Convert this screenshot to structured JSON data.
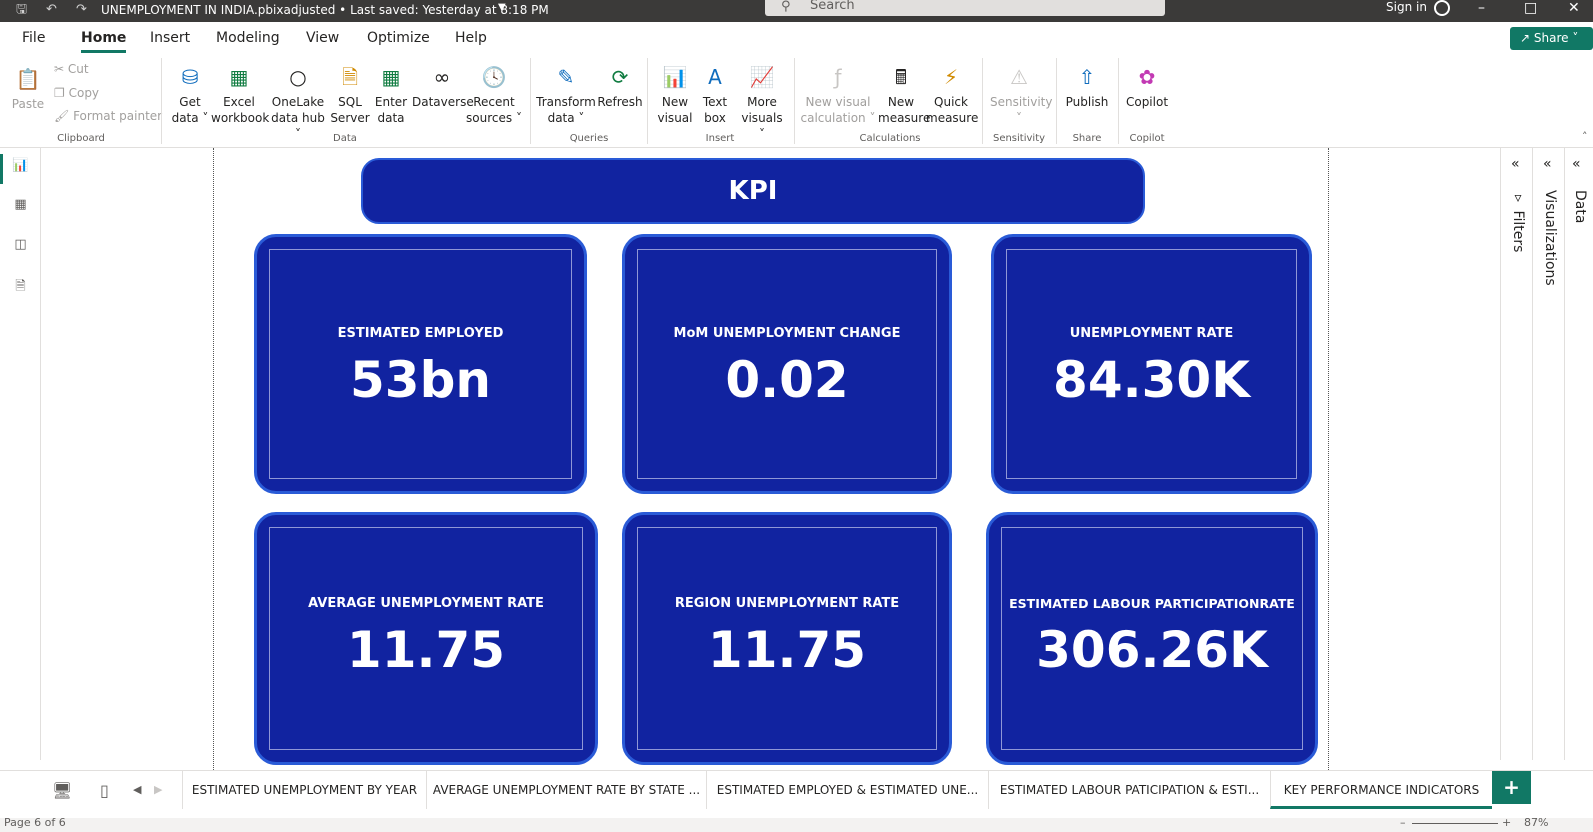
{
  "titlebar": {
    "document_title": "UNEMPLOYMENT IN INDIA.pbixadjusted",
    "saved_status": "• Last saved: Yesterday at 8:18 PM",
    "search_placeholder": "Search",
    "sign_in": "Sign in"
  },
  "menu": {
    "tabs": [
      "File",
      "Home",
      "Insert",
      "Modeling",
      "View",
      "Optimize",
      "Help"
    ],
    "active": "Home",
    "share_label": "Share"
  },
  "ribbon": {
    "clipboard": {
      "paste": "Paste",
      "cut": "Cut",
      "copy": "Copy",
      "format_painter": "Format painter",
      "group": "Clipboard"
    },
    "data": {
      "get_data": [
        "Get",
        "data ˅"
      ],
      "excel": [
        "Excel",
        "workbook"
      ],
      "onelake": [
        "OneLake",
        "data hub ˅"
      ],
      "sql": [
        "SQL",
        "Server"
      ],
      "enter": [
        "Enter",
        "data"
      ],
      "dataverse": [
        "Dataverse"
      ],
      "recent": [
        "Recent",
        "sources ˅"
      ],
      "group": "Data"
    },
    "queries": {
      "transform": [
        "Transform",
        "data ˅"
      ],
      "refresh": [
        "Refresh"
      ],
      "group": "Queries"
    },
    "insert": {
      "new_visual": [
        "New",
        "visual"
      ],
      "text_box": [
        "Text",
        "box"
      ],
      "more_visuals": [
        "More",
        "visuals ˅"
      ],
      "group": "Insert"
    },
    "calculations": {
      "new_visual_calc": [
        "New visual",
        "calculation ˅"
      ],
      "new_measure": [
        "New",
        "measure"
      ],
      "quick_measure": [
        "Quick",
        "measure"
      ],
      "group": "Calculations"
    },
    "sensitivity": {
      "label": [
        "Sensitivity",
        "˅"
      ],
      "group": "Sensitivity"
    },
    "share": {
      "publish": [
        "Publish"
      ],
      "group": "Share"
    },
    "copilot": {
      "label": [
        "Copilot"
      ],
      "group": "Copilot"
    }
  },
  "report": {
    "banner": "KPI",
    "cards": [
      {
        "title": "ESTIMATED EMPLOYED",
        "value": "53bn"
      },
      {
        "title": "MoM UNEMPLOYMENT CHANGE",
        "value": "0.02"
      },
      {
        "title": "UNEMPLOYMENT RATE",
        "value": "84.30K"
      },
      {
        "title": "AVERAGE UNEMPLOYMENT RATE",
        "value": "11.75"
      },
      {
        "title": "REGION UNEMPLOYMENT RATE",
        "value": "11.75"
      },
      {
        "title": "ESTIMATED LABOUR PARTICIPATIONRATE",
        "value": "306.26K"
      }
    ]
  },
  "panes": {
    "filters": "Filters",
    "visualizations": "Visualizations",
    "data": "Data"
  },
  "page_tabs": [
    "ESTIMATED UNEMPLOYMENT BY YEAR",
    "AVERAGE UNEMPLOYMENT RATE BY STATE ...",
    "ESTIMATED EMPLOYED & ESTIMATED UNE...",
    "ESTIMATED LABOUR PATICIPATION & ESTI...",
    "KEY PERFORMANCE INDICATORS"
  ],
  "active_page_tab": "KEY PERFORMANCE INDICATORS",
  "status": {
    "page": "Page 6 of 6",
    "zoom": "87%"
  },
  "colors": {
    "card_fill": "#1123a0",
    "card_border": "#2a5bd7",
    "accent": "#117865"
  }
}
